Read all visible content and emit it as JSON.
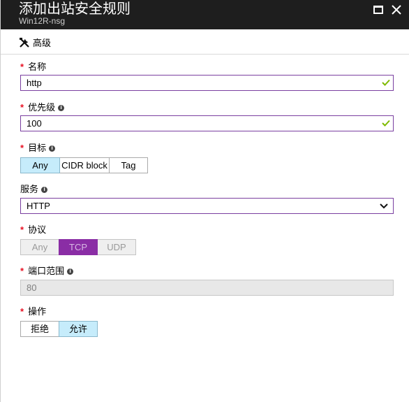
{
  "header": {
    "title": "添加出站安全规则",
    "subtitle": "Win12R-nsg"
  },
  "toolbar": {
    "advanced_label": "高级"
  },
  "form": {
    "name": {
      "label": "名称",
      "value": "http",
      "required": true,
      "valid": true
    },
    "priority": {
      "label": "优先级",
      "value": "100",
      "required": true,
      "valid": true
    },
    "destination": {
      "label": "目标",
      "required": true,
      "options": [
        "Any",
        "CIDR block",
        "Tag"
      ],
      "selected": "Any"
    },
    "service": {
      "label": "服务",
      "value": "HTTP"
    },
    "protocol": {
      "label": "协议",
      "required": true,
      "options": [
        "Any",
        "TCP",
        "UDP"
      ],
      "selected": "TCP",
      "disabled": true
    },
    "port_range": {
      "label": "端口范围",
      "required": true,
      "value": "80",
      "disabled": true
    },
    "action": {
      "label": "操作",
      "required": true,
      "options": [
        "拒绝",
        "允许"
      ],
      "selected": "允许"
    }
  },
  "colors": {
    "titlebar": "#1e1e1e",
    "required": "#e81123",
    "focus_border": "#7a3fa0",
    "selected_blue": "#c6ecfb",
    "selected_purple": "#8a2da5",
    "valid_check": "#7fba00"
  },
  "icons": {
    "maximize": "maximize-icon",
    "close": "close-icon",
    "advanced": "tools-icon",
    "info": "info-icon",
    "valid": "check-icon",
    "dropdown": "chevron-down-icon"
  }
}
